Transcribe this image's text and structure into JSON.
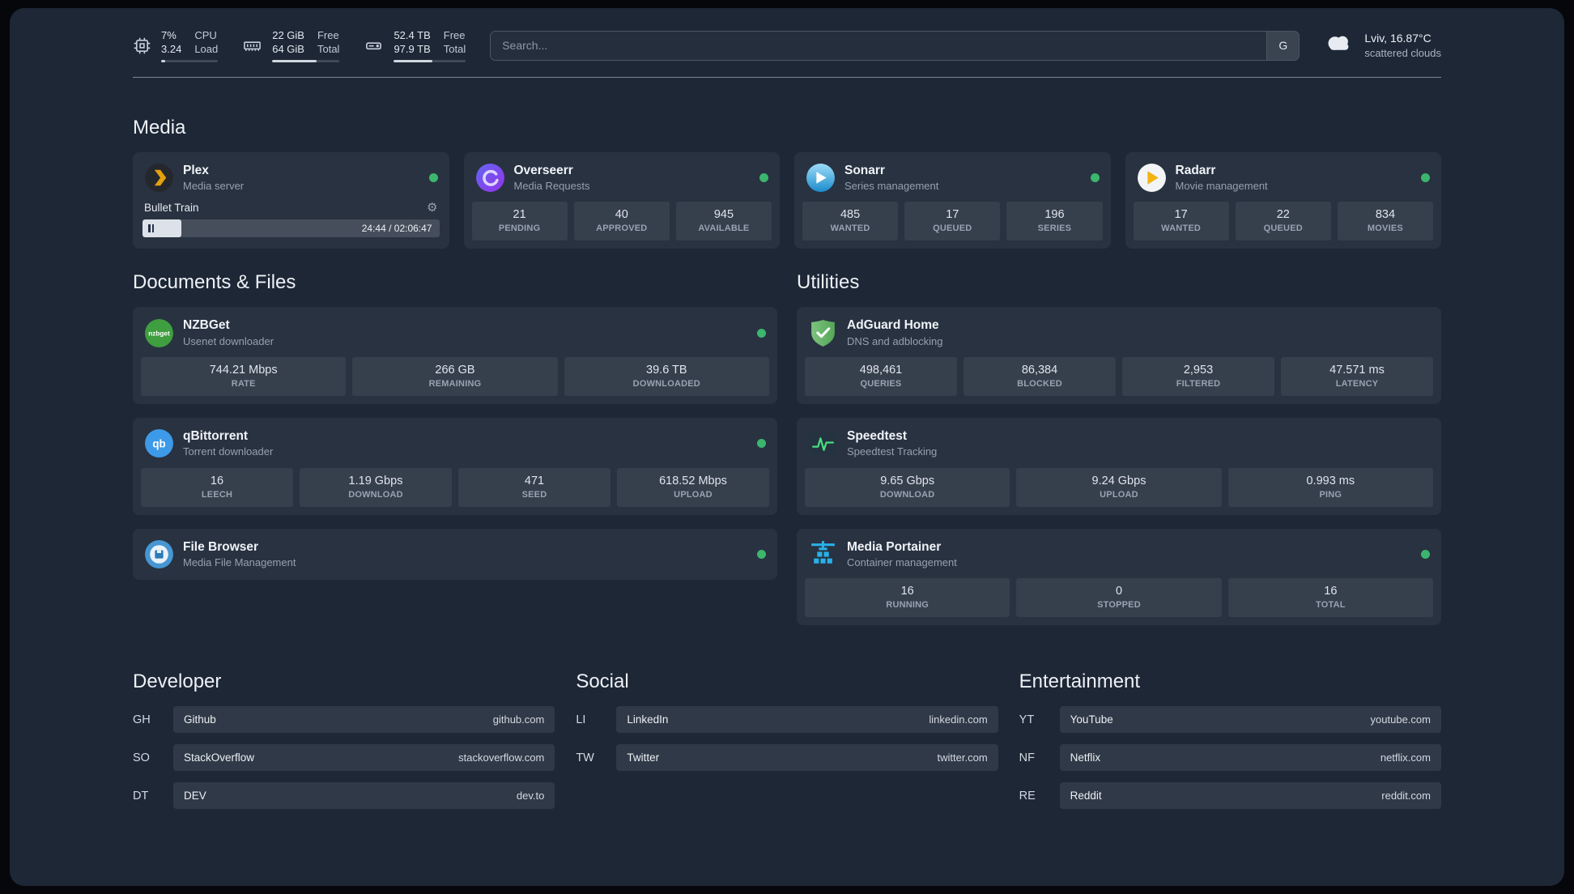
{
  "topbar": {
    "cpu": {
      "value": "7%",
      "sub": "3.24",
      "label_top": "CPU",
      "label_bottom": "Load",
      "progress": 7
    },
    "memory": {
      "value": "22 GiB",
      "sub": "64 GiB",
      "label_top": "Free",
      "label_bottom": "Total",
      "progress": 66
    },
    "disk": {
      "value": "52.4 TB",
      "sub": "97.9 TB",
      "label_top": "Free",
      "label_bottom": "Total",
      "progress": 54
    },
    "search": {
      "placeholder": "Search...",
      "button_label": "G"
    },
    "weather": {
      "location": "Lviv, 16.87°C",
      "condition": "scattered clouds"
    }
  },
  "sections": {
    "media": {
      "title": "Media",
      "cards": [
        {
          "name": "Plex",
          "description": "Media server",
          "player": {
            "title": "Bullet Train",
            "time": "24:44 / 02:06:47",
            "progress": 13
          }
        },
        {
          "name": "Overseerr",
          "description": "Media Requests",
          "stats": [
            {
              "value": "21",
              "label": "PENDING"
            },
            {
              "value": "40",
              "label": "APPROVED"
            },
            {
              "value": "945",
              "label": "AVAILABLE"
            }
          ]
        },
        {
          "name": "Sonarr",
          "description": "Series management",
          "stats": [
            {
              "value": "485",
              "label": "WANTED"
            },
            {
              "value": "17",
              "label": "QUEUED"
            },
            {
              "value": "196",
              "label": "SERIES"
            }
          ]
        },
        {
          "name": "Radarr",
          "description": "Movie management",
          "stats": [
            {
              "value": "17",
              "label": "WANTED"
            },
            {
              "value": "22",
              "label": "QUEUED"
            },
            {
              "value": "834",
              "label": "MOVIES"
            }
          ]
        }
      ]
    },
    "documents": {
      "title": "Documents & Files",
      "cards": [
        {
          "name": "NZBGet",
          "description": "Usenet downloader",
          "stats": [
            {
              "value": "744.21 Mbps",
              "label": "RATE"
            },
            {
              "value": "266 GB",
              "label": "REMAINING"
            },
            {
              "value": "39.6 TB",
              "label": "DOWNLOADED"
            }
          ]
        },
        {
          "name": "qBittorrent",
          "description": "Torrent downloader",
          "stats": [
            {
              "value": "16",
              "label": "LEECH"
            },
            {
              "value": "1.19 Gbps",
              "label": "DOWNLOAD"
            },
            {
              "value": "471",
              "label": "SEED"
            },
            {
              "value": "618.52 Mbps",
              "label": "UPLOAD"
            }
          ]
        },
        {
          "name": "File Browser",
          "description": "Media File Management",
          "stats": []
        }
      ]
    },
    "utilities": {
      "title": "Utilities",
      "cards": [
        {
          "name": "AdGuard Home",
          "description": "DNS and adblocking",
          "stats": [
            {
              "value": "498,461",
              "label": "QUERIES"
            },
            {
              "value": "86,384",
              "label": "BLOCKED"
            },
            {
              "value": "2,953",
              "label": "FILTERED"
            },
            {
              "value": "47.571 ms",
              "label": "LATENCY"
            }
          ]
        },
        {
          "name": "Speedtest",
          "description": "Speedtest Tracking",
          "stats": [
            {
              "value": "9.65 Gbps",
              "label": "DOWNLOAD"
            },
            {
              "value": "9.24 Gbps",
              "label": "UPLOAD"
            },
            {
              "value": "0.993 ms",
              "label": "PING"
            }
          ]
        },
        {
          "name": "Media Portainer",
          "description": "Container management",
          "stats": [
            {
              "value": "16",
              "label": "RUNNING"
            },
            {
              "value": "0",
              "label": "STOPPED"
            },
            {
              "value": "16",
              "label": "TOTAL"
            }
          ]
        }
      ]
    }
  },
  "bookmarks": [
    {
      "title": "Developer",
      "items": [
        {
          "abbr": "GH",
          "name": "Github",
          "domain": "github.com"
        },
        {
          "abbr": "SO",
          "name": "StackOverflow",
          "domain": "stackoverflow.com"
        },
        {
          "abbr": "DT",
          "name": "DEV",
          "domain": "dev.to"
        }
      ]
    },
    {
      "title": "Social",
      "items": [
        {
          "abbr": "LI",
          "name": "LinkedIn",
          "domain": "linkedin.com"
        },
        {
          "abbr": "TW",
          "name": "Twitter",
          "domain": "twitter.com"
        }
      ]
    },
    {
      "title": "Entertainment",
      "items": [
        {
          "abbr": "YT",
          "name": "YouTube",
          "domain": "youtube.com"
        },
        {
          "abbr": "NF",
          "name": "Netflix",
          "domain": "netflix.com"
        },
        {
          "abbr": "RE",
          "name": "Reddit",
          "domain": "reddit.com"
        }
      ]
    }
  ],
  "colors": {
    "background": "#1d2736",
    "status_online": "#3cb56d",
    "plex_accent": "#e5a00d",
    "speedtest_graph": "#4ade80"
  }
}
